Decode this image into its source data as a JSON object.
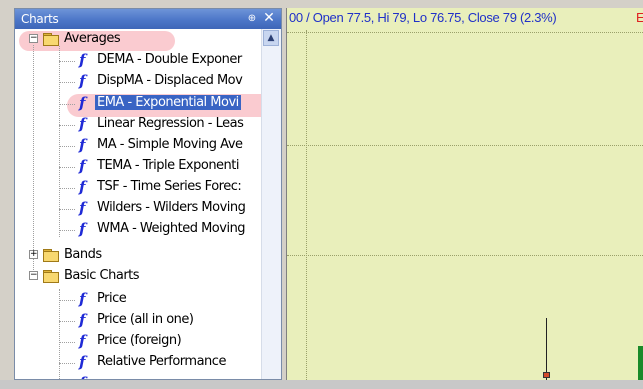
{
  "panel": {
    "title": "Charts",
    "pin_glyph": "⊕",
    "close_glyph": "✕"
  },
  "tree": {
    "groups": [
      {
        "label": "Averages",
        "expanded": true,
        "items": [
          "DEMA - Double Exponer",
          "DispMA - Displaced Mov",
          "EMA - Exponential Movi",
          "Linear Regression - Leas",
          "MA - Simple Moving Ave",
          "TEMA - Triple Exponenti",
          "TSF - Time Series Forec:",
          "Wilders - Wilders Moving",
          "WMA - Weighted Moving"
        ]
      },
      {
        "label": "Bands",
        "expanded": false,
        "items": []
      },
      {
        "label": "Basic Charts",
        "expanded": true,
        "items": [
          "Price",
          "Price (all in one)",
          "Price (foreign)",
          "Relative Performance"
        ]
      }
    ],
    "selected_item": "EMA - Exponential Movi",
    "function_glyph": "f",
    "expand_minus": "−",
    "expand_plus": "+"
  },
  "chart": {
    "info_text": "00 / Open 77.5, Hi 79, Lo 76.75, Close 79 (2.3%)",
    "info_tail": "E",
    "background": "#e9efbb"
  },
  "colors": {
    "accent": "#4c76c8",
    "selection": "#3964c4",
    "highlight": "#f6a0aa",
    "function_icon": "#1f2ad6"
  }
}
